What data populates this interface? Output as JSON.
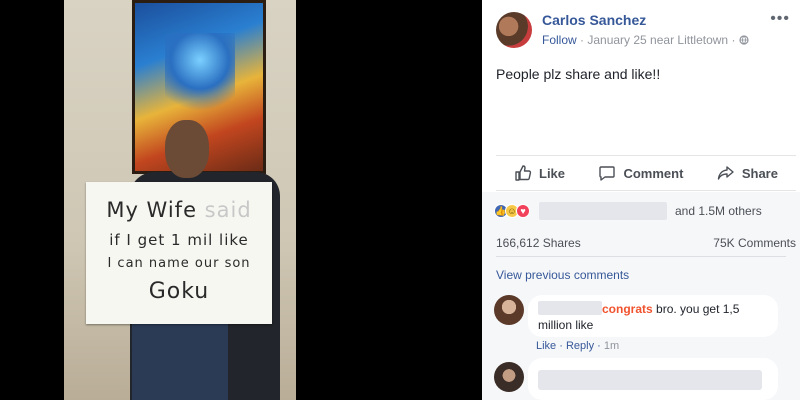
{
  "photo": {
    "sign_lines": {
      "l1_start": "My Wife",
      "l1_faded": " said",
      "l2": "if I get 1 mil like",
      "l3": "I can name our son",
      "l4": "Goku"
    }
  },
  "post": {
    "author": "Carlos Sanchez",
    "follow": "Follow",
    "meta": " · January 25 near Littletown · ",
    "globe_icon": "globe-icon",
    "menu_icon": "more-options-icon",
    "text": "People plz share and like!!"
  },
  "actions": {
    "like": "Like",
    "comment": "Comment",
    "share": "Share"
  },
  "reactions": {
    "icons": [
      "like-icon",
      "haha-icon",
      "love-icon"
    ],
    "count": "and 1.5M others"
  },
  "stats": {
    "shares": "166,612 Shares",
    "comments": "75K Comments"
  },
  "view_previous": "View previous comments",
  "comments": [
    {
      "highlight": "congrats",
      "text": " bro. you get 1,5 million like",
      "meta_like": "Like",
      "meta_reply": "Reply",
      "meta_time": "1m"
    }
  ],
  "colors": {
    "link_blue": "#365899",
    "highlight": "#f0532e",
    "like_blue": "#4267b2",
    "love_red": "#f2415a"
  }
}
